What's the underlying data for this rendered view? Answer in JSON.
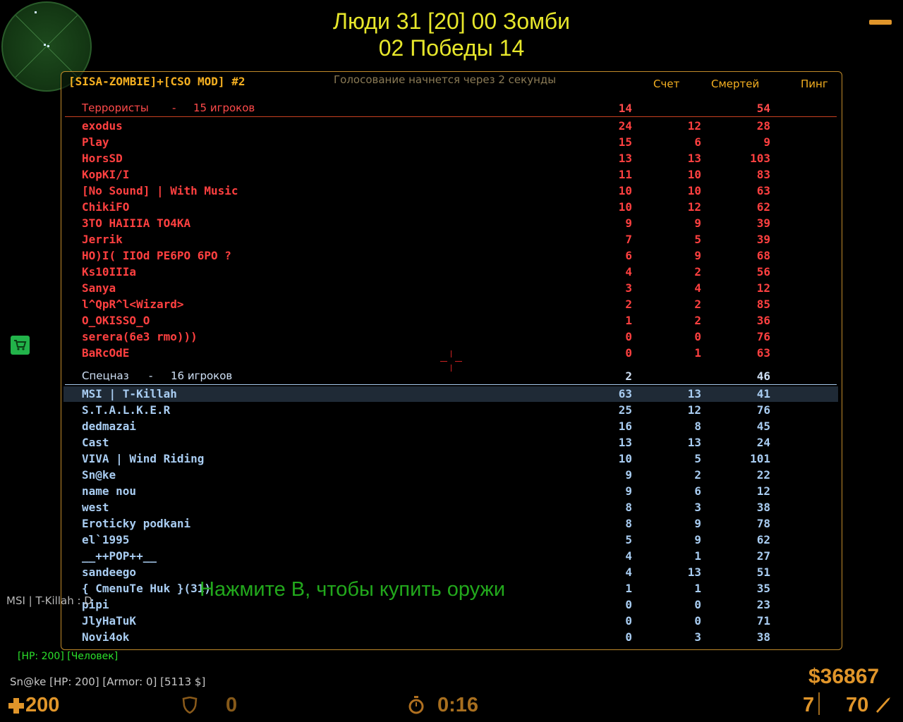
{
  "hud_top": {
    "line1": "Люди 31 [20] 00 Зомби",
    "line2": "02 Победы 14"
  },
  "scoreboard": {
    "server_name": "[SISA-ZOMBIE]+[CSO MOD] #2",
    "vote_notice": "Голосование начнется через 2 секунды",
    "columns": {
      "score": "Счет",
      "deaths": "Смертей",
      "ping": "Пинг"
    },
    "terrorists": {
      "label": "Террористы",
      "dash": "-",
      "count": "15 игроков",
      "score": "14",
      "deaths": "54",
      "players": [
        {
          "name": "exodus",
          "score": "24",
          "deaths": "12",
          "ping": "28"
        },
        {
          "name": "Play",
          "score": "15",
          "deaths": "6",
          "ping": "9"
        },
        {
          "name": "HorsSD",
          "score": "13",
          "deaths": "13",
          "ping": "103"
        },
        {
          "name": "KopKI/I",
          "score": "11",
          "deaths": "10",
          "ping": "83"
        },
        {
          "name": "[No Sound] | With Music",
          "score": "10",
          "deaths": "10",
          "ping": "63"
        },
        {
          "name": "ChikiFO",
          "score": "10",
          "deaths": "12",
          "ping": "62"
        },
        {
          "name": "ЗTO HAIIIA TO4KA",
          "score": "9",
          "deaths": "9",
          "ping": "39"
        },
        {
          "name": "Jerrik",
          "score": "7",
          "deaths": "5",
          "ping": "39"
        },
        {
          "name": "HO)I( IIOd PE6PO 6PO ?",
          "score": "6",
          "deaths": "9",
          "ping": "68"
        },
        {
          "name": "Ks10IIIa",
          "score": "4",
          "deaths": "2",
          "ping": "56"
        },
        {
          "name": "Sanya",
          "score": "3",
          "deaths": "4",
          "ping": "12"
        },
        {
          "name": "l^QpR^l<Wizard>",
          "score": "2",
          "deaths": "2",
          "ping": "85"
        },
        {
          "name": "O_OKISSO_O",
          "score": "1",
          "deaths": "2",
          "ping": "36"
        },
        {
          "name": "serera(6e3 rmo)))",
          "score": "0",
          "deaths": "0",
          "ping": "76"
        },
        {
          "name": "BaRcOdE",
          "score": "0",
          "deaths": "1",
          "ping": "63"
        }
      ]
    },
    "ct": {
      "label": "Спецназ",
      "dash": "-",
      "count": "16 игроков",
      "score": "2",
      "deaths": "46",
      "players": [
        {
          "name": "MSI | T-Killah",
          "score": "63",
          "deaths": "13",
          "ping": "41"
        },
        {
          "name": "S.T.A.L.K.E.R",
          "score": "25",
          "deaths": "12",
          "ping": "76"
        },
        {
          "name": "dedmazai",
          "score": "16",
          "deaths": "8",
          "ping": "45"
        },
        {
          "name": "Cast",
          "score": "13",
          "deaths": "13",
          "ping": "24"
        },
        {
          "name": "VIVA | Wind Riding",
          "score": "10",
          "deaths": "5",
          "ping": "101"
        },
        {
          "name": "Sn@ke",
          "score": "9",
          "deaths": "2",
          "ping": "22"
        },
        {
          "name": "name nou",
          "score": "9",
          "deaths": "6",
          "ping": "12"
        },
        {
          "name": "west",
          "score": "8",
          "deaths": "3",
          "ping": "38"
        },
        {
          "name": "Eroticky podkani",
          "score": "8",
          "deaths": "9",
          "ping": "78"
        },
        {
          "name": "el`1995",
          "score": "5",
          "deaths": "9",
          "ping": "62"
        },
        {
          "name": "__++POP++__",
          "score": "4",
          "deaths": "1",
          "ping": "27"
        },
        {
          "name": "sandeego",
          "score": "4",
          "deaths": "13",
          "ping": "51"
        },
        {
          "name": "{ CmenuTe Huk }(31)",
          "score": "1",
          "deaths": "1",
          "ping": "35"
        },
        {
          "name": "pipi",
          "score": "0",
          "deaths": "0",
          "ping": "23"
        },
        {
          "name": "JlyHaTuK",
          "score": "0",
          "deaths": "0",
          "ping": "71"
        },
        {
          "name": "Novi4ok",
          "score": "0",
          "deaths": "3",
          "ping": "38"
        }
      ]
    }
  },
  "messages": {
    "buy_hint": "Нажмите B, чтобы купить оружи",
    "chat": "MSI | T-Killah : D",
    "hp_status": "[HP: 200] [Человек]",
    "player_status": "Sn@ke [HP: 200] [Armor: 0] [5113 $]"
  },
  "hud": {
    "money": "$36867",
    "health": "200",
    "armor": "0",
    "timer": "0:16",
    "ammo_clip": "7",
    "ammo_total": "70"
  },
  "colors": {
    "terrorist": "#ff4040",
    "ct": "#a9cdf2",
    "hud": "#e0952a",
    "title": "#e7e72b"
  }
}
